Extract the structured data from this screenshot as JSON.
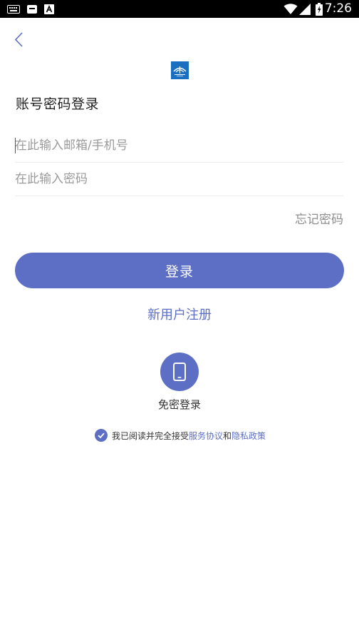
{
  "status_bar": {
    "time": "7:26"
  },
  "icons": {
    "back": "chevron-left-icon",
    "logo": "app-logo",
    "phone": "smartphone-icon",
    "check": "check-circle-icon"
  },
  "login": {
    "title": "账号密码登录",
    "email_placeholder": "在此输入邮箱/手机号",
    "password_placeholder": "在此输入密码",
    "forgot_password": "忘记密码",
    "submit_label": "登录",
    "register_label": "新用户注册",
    "passwordless_label": "免密登录"
  },
  "agreement": {
    "prefix": "我已阅读并完全接受",
    "service_terms": "服务协议",
    "conjunction": "和",
    "privacy_policy": "隐私政策",
    "checked": true
  },
  "colors": {
    "accent": "#5c6fc4",
    "placeholder": "#9a9a9a",
    "divider": "#ececec"
  }
}
